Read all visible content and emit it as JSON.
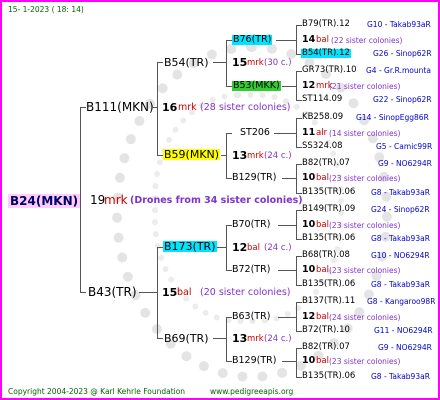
{
  "header": {
    "date": "15-  1-2023 ( 18: 14)"
  },
  "footer": {
    "copyright": "Copyright 2004-2023 @ Karl Kehrle Foundation",
    "site": "www.pedigreeapis.org"
  },
  "colors": {
    "frame": "#ff00ff",
    "green_text": "#006600",
    "mrk_red": "#cc0000",
    "bal_red": "#cc0000",
    "colony_purple": "#8033cc",
    "sister_blue": "#0000cc",
    "cyan_box": "#00e5ff",
    "green_box": "#33cc33",
    "yellow_box": "#ffff00"
  },
  "root": {
    "name": "B24(MKN)",
    "count": "19",
    "mark": "mrk",
    "note": "(Drones from 34 sister colonies)"
  },
  "gen1": [
    {
      "name": "B111(MKN)",
      "count": "16",
      "mark": "mrk",
      "note": "(28 sister colonies)"
    },
    {
      "name": "B43(TR)",
      "count": "15",
      "mark": "bal",
      "note": "(20 sister colonies)"
    }
  ],
  "gen2": [
    {
      "name": "B54(TR)",
      "count": "15",
      "mark": "mrk",
      "note": "(30 c.)"
    },
    {
      "name": "B59(MKN)",
      "count": "13",
      "mark": "mrk",
      "note": "(24 c.)"
    },
    {
      "name": "B173(TR)",
      "count": "12",
      "mark": "bal",
      "note": "(24 c.)"
    },
    {
      "name": "B69(TR)",
      "count": "13",
      "mark": "mrk",
      "note": "(24 c.)"
    }
  ],
  "gen3": [
    {
      "name": "B76(TR)",
      "count": "14",
      "mark": "bal",
      "note": "(22 sister colonies)"
    },
    {
      "name": "B53(MKK)",
      "count": "12",
      "mark": "mrk",
      "note": "(21 sister colonies)"
    },
    {
      "name": "ST206",
      "count": "11",
      "mark": "alr",
      "note": "(14 sister colonies)"
    },
    {
      "name": "B129(TR)",
      "count": "10",
      "mark": "bal",
      "note": "(23 sister colonies)"
    },
    {
      "name": "B70(TR)",
      "count": "10",
      "mark": "bal",
      "note": "(23 sister colonies)"
    },
    {
      "name": "B72(TR)",
      "count": "10",
      "mark": "bal",
      "note": "(23 sister colonies)"
    },
    {
      "name": "B63(TR)",
      "count": "12",
      "mark": "bal",
      "note": "(24 sister colonies)"
    },
    {
      "name": "B129(TR)",
      "count": "10",
      "mark": "bal",
      "note": "(23 sister colonies)"
    }
  ],
  "gen4": [
    {
      "left": "B79(TR).12",
      "right": "G10 - Takab93aR"
    },
    {
      "left": "B54(TR).12",
      "right": "G26 - Sinop62R"
    },
    {
      "left": "GR73(TR).10",
      "right": "G4 - Gr.R.mounta"
    },
    {
      "left": "ST114.09",
      "right": "G22 - Sinop62R"
    },
    {
      "left": "KB258.09",
      "right": "G14 - SinopEgg86R"
    },
    {
      "left": "SS324.08",
      "right": "G5 - Camic99R"
    },
    {
      "left": "B82(TR).07",
      "right": "G9 - NO6294R"
    },
    {
      "left": "B135(TR).06",
      "right": "G8 - Takab93aR"
    },
    {
      "left": "B149(TR).09",
      "right": "G24 - Sinop62R"
    },
    {
      "left": "B135(TR).06",
      "right": "G8 - Takab93aR"
    },
    {
      "left": "B68(TR).08",
      "right": "G10 - NO6294R"
    },
    {
      "left": "B135(TR).06",
      "right": "G8 - Takab93aR"
    },
    {
      "left": "B137(TR).11",
      "right": "G8 - Kangaroo98R"
    },
    {
      "left": "B72(TR).10",
      "right": "G11 - NO6294R"
    },
    {
      "left": "B82(TR).07",
      "right": "G9 - NO6294R"
    },
    {
      "left": "B135(TR).06",
      "right": "G8 - Takab93aR"
    }
  ]
}
